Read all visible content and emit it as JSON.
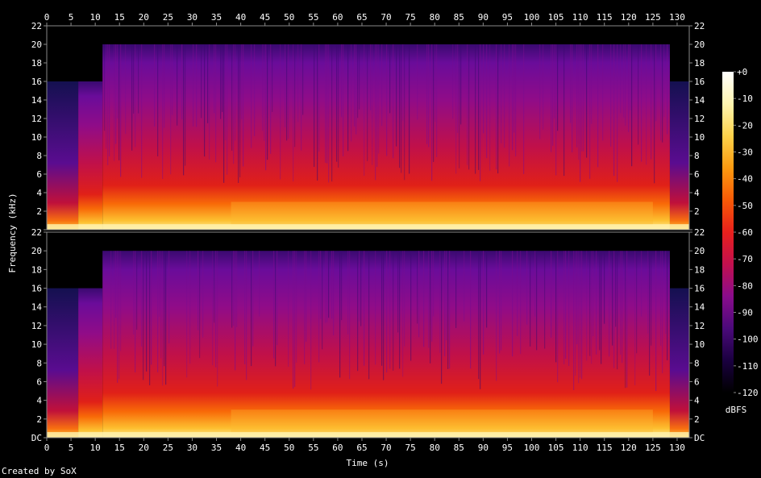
{
  "chart_data": {
    "type": "heatmap",
    "subtype": "spectrogram",
    "xlabel": "Time (s)",
    "ylabel": "Frequency (kHz)",
    "x_ticks": [
      0,
      5,
      10,
      15,
      20,
      25,
      30,
      35,
      40,
      45,
      50,
      55,
      60,
      65,
      70,
      75,
      80,
      85,
      90,
      95,
      100,
      105,
      110,
      115,
      120,
      125,
      130
    ],
    "xlim": [
      0,
      132.5
    ],
    "y_ticks": [
      "DC",
      "2",
      "4",
      "6",
      "8",
      "10",
      "12",
      "14",
      "16",
      "18",
      "20",
      "22"
    ],
    "y_tick_values": [
      0,
      2,
      4,
      6,
      8,
      10,
      12,
      14,
      16,
      18,
      20,
      22
    ],
    "ylim": [
      0,
      22
    ],
    "channels": [
      {
        "y_ticks": [
          "",
          "2",
          "4",
          "6",
          "8",
          "10",
          "12",
          "14",
          "16",
          "18",
          "20",
          "22"
        ]
      },
      {
        "y_ticks": [
          "DC",
          "2",
          "4",
          "6",
          "8",
          "10",
          "12",
          "14",
          "16",
          "18",
          "20",
          "22"
        ]
      }
    ],
    "colorbar": {
      "unit": "dBFS",
      "ticks": [
        "+0",
        "-10",
        "-20",
        "-30",
        "-40",
        "-50",
        "-60",
        "-70",
        "-80",
        "-90",
        "-100",
        "-110",
        "-120"
      ],
      "tick_values": [
        0,
        -10,
        -20,
        -30,
        -40,
        -50,
        -60,
        -70,
        -80,
        -90,
        -100,
        -110,
        -120
      ],
      "range": [
        -120,
        0
      ],
      "colors": [
        "#000000",
        "#1a0040",
        "#4b0a7a",
        "#8a0c8c",
        "#c2104e",
        "#e8201c",
        "#f85a06",
        "#fc9a10",
        "#fdd24a",
        "#fff5b0",
        "#ffffff"
      ]
    },
    "content_bands": [
      {
        "t_start": 0,
        "t_end": 6.5,
        "f_max_khz": 16
      },
      {
        "t_start": 6.5,
        "t_end": 11.5,
        "f_max_khz": 16
      },
      {
        "t_start": 11.5,
        "t_end": 128.5,
        "f_max_khz": 20
      },
      {
        "t_start": 128.5,
        "t_end": 132.5,
        "f_max_khz": 16
      }
    ]
  },
  "footer": {
    "credit": "Created by SoX"
  }
}
